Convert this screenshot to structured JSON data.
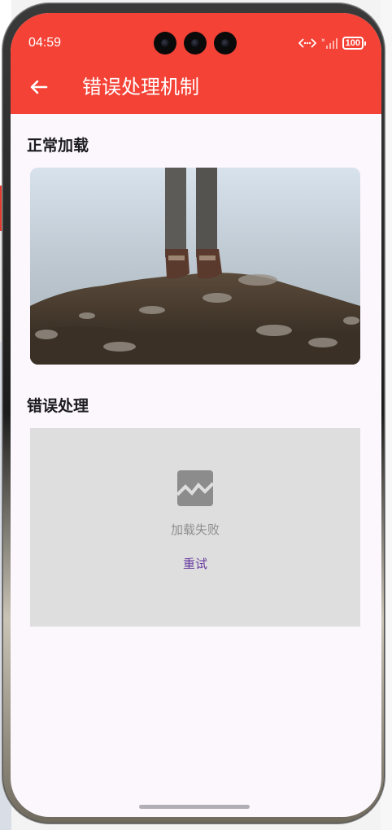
{
  "status_bar": {
    "time": "04:59",
    "battery": "100",
    "signal_mark": "ˣ.ıll"
  },
  "app_bar": {
    "title": "错误处理机制",
    "back_icon": "arrow-left-icon",
    "color": "#f44236"
  },
  "sections": {
    "normal": {
      "title": "正常加载"
    },
    "error": {
      "title": "错误处理",
      "message": "加载失败",
      "retry_label": "重试",
      "icon": "broken-image-icon"
    }
  },
  "colors": {
    "accent": "#f44236",
    "retry": "#6a3ea1",
    "background": "#fcf6fd",
    "error_card": "#dedede"
  }
}
